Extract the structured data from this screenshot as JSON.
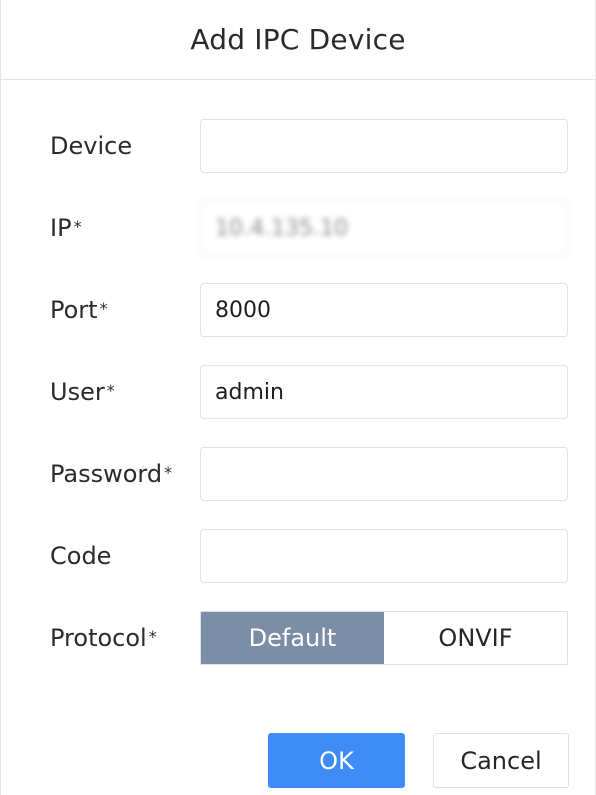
{
  "dialog": {
    "title": "Add IPC Device"
  },
  "fields": {
    "device": {
      "label": "Device",
      "value": ""
    },
    "ip": {
      "label": "IP",
      "value": "10.4.135.10"
    },
    "port": {
      "label": "Port",
      "value": "8000"
    },
    "user": {
      "label": "User",
      "value": "admin"
    },
    "password": {
      "label": "Password",
      "value": ""
    },
    "code": {
      "label": "Code",
      "value": ""
    }
  },
  "required_marker": "*",
  "protocol": {
    "label": "Protocol",
    "options": [
      "Default",
      "ONVIF"
    ],
    "selected": "Default"
  },
  "buttons": {
    "ok": "OK",
    "cancel": "Cancel"
  },
  "colors": {
    "selected_option": "#7b8ea6",
    "primary_button": "#3f8cf7"
  }
}
